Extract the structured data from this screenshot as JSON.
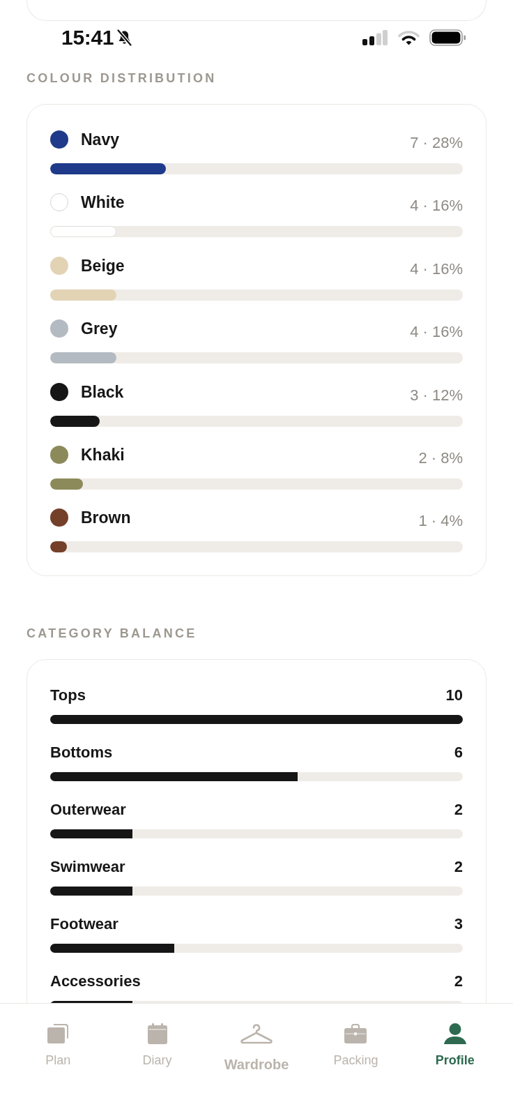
{
  "status_bar": {
    "time": "15:41"
  },
  "colour_distribution": {
    "title": "COLOUR DISTRIBUTION",
    "items": [
      {
        "name": "Navy",
        "color": "#1f3a8a",
        "level": 0.28,
        "reading": "7 · 28%"
      },
      {
        "name": "White",
        "color": "#ffffff",
        "level": 0.16,
        "reading": "4 · 16%"
      },
      {
        "name": "Beige",
        "color": "#e3d3b5",
        "level": 0.16,
        "reading": "4 · 16%"
      },
      {
        "name": "Grey",
        "color": "#b4bac2",
        "level": 0.16,
        "reading": "4 · 16%"
      },
      {
        "name": "Black",
        "color": "#161616",
        "level": 0.12,
        "reading": "3 · 12%"
      },
      {
        "name": "Khaki",
        "color": "#8c8a5a",
        "level": 0.08,
        "reading": "2 · 8%"
      },
      {
        "name": "Brown",
        "color": "#74402a",
        "level": 0.04,
        "reading": "1 · 4%"
      }
    ]
  },
  "category_balance": {
    "title": "CATEGORY BALANCE",
    "items": [
      {
        "name": "Tops",
        "count": "10",
        "level": 1.0
      },
      {
        "name": "Bottoms",
        "count": "6",
        "level": 0.6
      },
      {
        "name": "Outerwear",
        "count": "2",
        "level": 0.2
      },
      {
        "name": "Swimwear",
        "count": "2",
        "level": 0.2
      },
      {
        "name": "Footwear",
        "count": "3",
        "level": 0.3
      },
      {
        "name": "Accessories",
        "count": "2",
        "level": 0.2
      }
    ]
  },
  "bottom_nav": [
    {
      "label": "Plan",
      "kind": "tab",
      "selected": false
    },
    {
      "label": "Diary",
      "kind": "tab",
      "selected": false
    },
    {
      "label": "Wardrobe",
      "kind": "featured",
      "selected": false
    },
    {
      "label": "Packing",
      "kind": "tab",
      "selected": false
    },
    {
      "label": "Profile",
      "kind": "tab",
      "selected": true
    }
  ]
}
